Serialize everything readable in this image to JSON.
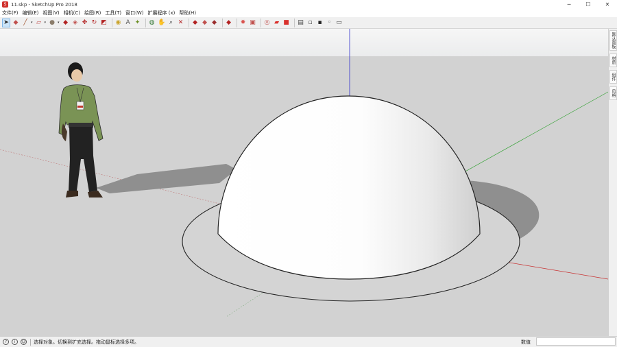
{
  "window": {
    "title": "11.skp - SketchUp Pro 2018",
    "icon": "sketchup-logo-icon",
    "minimize": "─",
    "maximize": "☐",
    "close": "✕"
  },
  "menu": [
    "文件(F)",
    "编辑(E)",
    "视图(V)",
    "相机(C)",
    "绘图(R)",
    "工具(T)",
    "窗口(W)",
    "扩展程序 (x)",
    "帮助(H)"
  ],
  "toolbar": {
    "buttons": [
      {
        "name": "select-tool-icon",
        "glyph": "➤",
        "color": "#222",
        "active": true
      },
      {
        "name": "eraser-tool-icon",
        "glyph": "◆",
        "color": "#c0504d"
      },
      {
        "name": "line-tool-icon",
        "glyph": "╱",
        "color": "#a0522d",
        "caret": true
      },
      {
        "name": "shapes-tool-icon",
        "glyph": "▱",
        "color": "#c0504d",
        "caret": true
      },
      {
        "name": "paint-bucket-icon",
        "glyph": "●",
        "color": "#8b7d6b",
        "caret": true
      },
      {
        "name": "push-pull-icon",
        "glyph": "◆",
        "color": "#b22222"
      },
      {
        "name": "offset-tool-icon",
        "glyph": "◈",
        "color": "#c0504d"
      },
      {
        "name": "move-tool-icon",
        "glyph": "✥",
        "color": "#b22222"
      },
      {
        "name": "rotate-tool-icon",
        "glyph": "↻",
        "color": "#b22222"
      },
      {
        "name": "scale-tool-icon",
        "glyph": "◩",
        "color": "#b22222"
      },
      {
        "name": "tape-measure-icon",
        "glyph": "◉",
        "color": "#c9a227",
        "sep_before": true
      },
      {
        "name": "text-tool-icon",
        "glyph": "A",
        "color": "#555"
      },
      {
        "name": "axes-tool-icon",
        "glyph": "✦",
        "color": "#6b8e23"
      },
      {
        "name": "orbit-tool-icon",
        "glyph": "◍",
        "color": "#3a7d3a",
        "sep_before": true
      },
      {
        "name": "pan-tool-icon",
        "glyph": "✋",
        "color": "#c9a227"
      },
      {
        "name": "zoom-tool-icon",
        "glyph": "⌕",
        "color": "#333"
      },
      {
        "name": "zoom-extents-icon",
        "glyph": "✕",
        "color": "#b22222"
      },
      {
        "name": "warehouse-icon",
        "glyph": "◆",
        "color": "#b22222",
        "sep_before": true
      },
      {
        "name": "components-icon",
        "glyph": "◆",
        "color": "#c0504d"
      },
      {
        "name": "extension-warehouse-icon",
        "glyph": "◆",
        "color": "#9b2d2d"
      },
      {
        "name": "layout-icon",
        "glyph": "◆",
        "color": "#b22222",
        "sep_before": true
      },
      {
        "name": "sun-settings-icon",
        "glyph": "✹",
        "color": "#d9534f",
        "sep_before": true
      },
      {
        "name": "section-plane-icon",
        "glyph": "▣",
        "color": "#c0504d"
      },
      {
        "name": "style-builder-icon",
        "glyph": "◎",
        "color": "#c0504d",
        "sep_before": true
      },
      {
        "name": "folder-icon",
        "glyph": "▰",
        "color": "#d9302c"
      },
      {
        "name": "camera-icon",
        "glyph": "■",
        "color": "#d9302c"
      },
      {
        "name": "iso-view-icon",
        "glyph": "▤",
        "color": "#444",
        "sep_before": true
      },
      {
        "name": "front-view-icon",
        "glyph": "▫",
        "color": "#444"
      },
      {
        "name": "top-view-icon",
        "glyph": "▪",
        "color": "#222"
      },
      {
        "name": "right-view-icon",
        "glyph": "◦",
        "color": "#444"
      },
      {
        "name": "back-view-icon",
        "glyph": "▭",
        "color": "#444"
      }
    ]
  },
  "tray": {
    "tabs": [
      "默认面板",
      "材质",
      "组件",
      "风格"
    ]
  },
  "status": {
    "text": "选择对象。切换到扩充选择。拖动鼠标选择多项。",
    "measure_label": "数值",
    "icons": [
      "geolocation-icon",
      "credits-icon",
      "user-icon"
    ]
  }
}
